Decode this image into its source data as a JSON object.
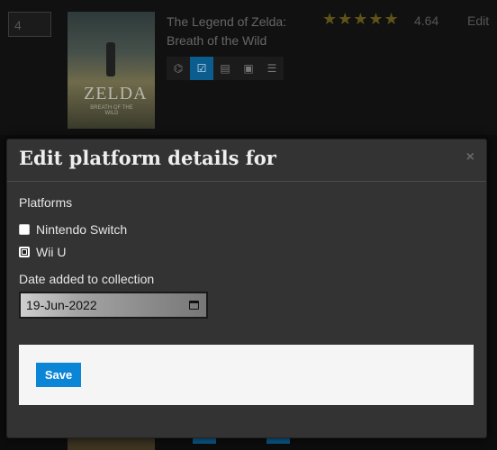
{
  "list_row": {
    "rank_value": "4",
    "cover_logo": "ZELDA",
    "cover_logo_sub": "BREATH OF THE WILD",
    "game_title": "The Legend of Zelda: Breath of the Wild",
    "stars": "★★★★★",
    "star_rating": 4.64,
    "rating_text": "4.64",
    "edit_label": "Edit",
    "tools": [
      {
        "icon": "gamepad-icon",
        "glyph": "⌬"
      },
      {
        "icon": "checkbox-icon",
        "glyph": "☑"
      },
      {
        "icon": "list-icon",
        "glyph": "▤"
      },
      {
        "icon": "save-icon",
        "glyph": "▣"
      },
      {
        "icon": "menu-icon",
        "glyph": "☰"
      }
    ]
  },
  "modal": {
    "title": "Edit platform details for",
    "close_glyph": "×",
    "platforms_label": "Platforms",
    "platforms": [
      {
        "label": "Nintendo Switch",
        "checked": false
      },
      {
        "label": "Wii U",
        "checked": true
      }
    ],
    "date_label": "Date added to collection",
    "date_value": "19-Jun-2022",
    "save_label": "Save"
  },
  "colors": {
    "accent": "#0b85d6",
    "modal_bg": "#333333",
    "footer_bg": "#f5f5f5"
  }
}
